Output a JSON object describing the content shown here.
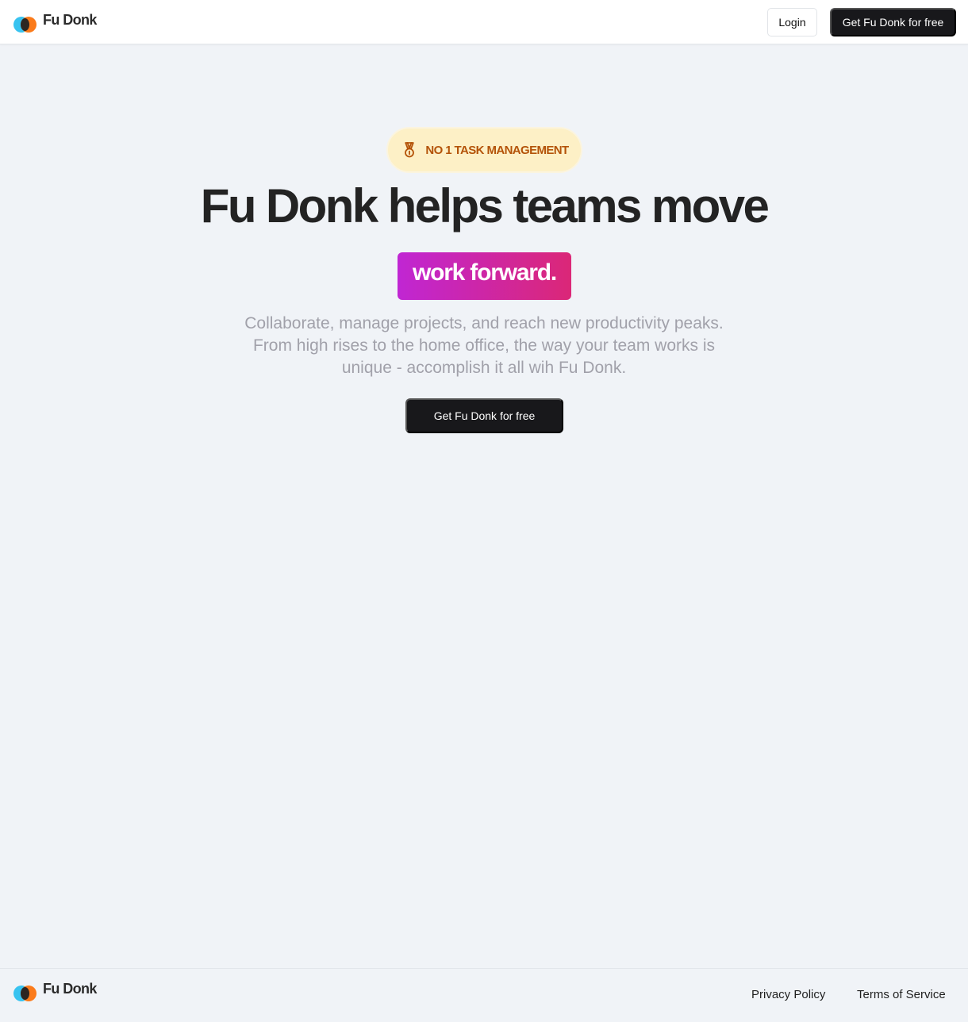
{
  "header": {
    "brand": "Fu Donk",
    "login_label": "Login",
    "cta_label": "Get Fu Donk for free"
  },
  "hero": {
    "badge_icon": "medal-icon",
    "badge_text": "NO 1 TASK MANAGEMENT",
    "headline": "Fu Donk helps teams move",
    "highlight": "work forward.",
    "subtitle_lines": [
      "Collaborate, manage projects, and reach new productivity peaks.",
      "From high rises to the home office, the way your team works is",
      "unique - accomplish it all wih Fu Donk."
    ],
    "cta_label": "Get Fu Donk for free"
  },
  "footer": {
    "brand": "Fu Donk",
    "links": [
      "Privacy Policy",
      "Terms of Service"
    ]
  },
  "colors": {
    "background": "#f0f3f7",
    "dark_button": "#18181b",
    "badge_bg": "#fdf0c6",
    "badge_text": "#b45309",
    "gradient_start": "#c026d3",
    "gradient_end": "#db2777",
    "logo_blue": "#38c3f0",
    "logo_orange": "#fb7b1b"
  }
}
